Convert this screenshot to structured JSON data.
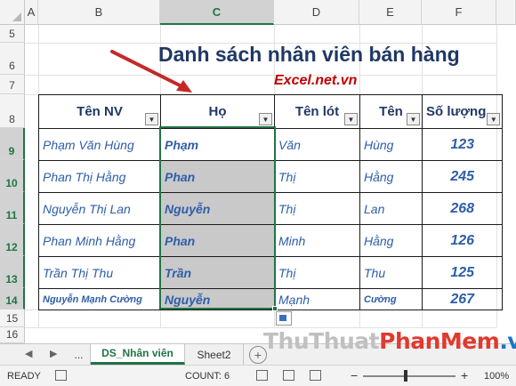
{
  "columns": [
    "A",
    "B",
    "C",
    "D",
    "E",
    "F"
  ],
  "rows": [
    "5",
    "6",
    "7",
    "8",
    "9",
    "10",
    "11",
    "12",
    "13",
    "14",
    "15",
    "16"
  ],
  "title": "Danh sách nhân viên bán hàng",
  "watermark": "Excel.net.vn",
  "table": {
    "headers": [
      "Tên NV",
      "Họ",
      "Tên lót",
      "Tên",
      "Số lượng"
    ],
    "rows": [
      [
        "Phạm Văn Hùng",
        "Phạm",
        "Văn",
        "Hùng",
        "123"
      ],
      [
        "Phan Thị Hằng",
        "Phan",
        "Thị",
        "Hằng",
        "245"
      ],
      [
        "Nguyễn Thị Lan",
        "Nguyễn",
        "Thị",
        "Lan",
        "268"
      ],
      [
        "Phan Minh Hằng",
        "Phan",
        "Minh",
        "Hằng",
        "126"
      ],
      [
        "Trần Thị Thu",
        "Trần",
        "Thị",
        "Thu",
        "125"
      ],
      [
        "Nguyễn Mạnh Cường",
        "Nguyễn",
        "Mạnh",
        "Cường",
        "267"
      ]
    ]
  },
  "tabs": {
    "ellipsis": "...",
    "active": "DS_Nhân viên",
    "other": "Sheet2",
    "add": "+"
  },
  "brand": {
    "part1": "Thu",
    "part2": "Thuat",
    "part3": "PhanMem",
    "part4": ".vn"
  },
  "status": {
    "ready": "READY",
    "count": "COUNT: 6",
    "zoom": "100%",
    "minus": "−",
    "plus": "+"
  },
  "colors": {
    "accent": "#217346",
    "title": "#1f3864",
    "cell_text": "#2e5ea8",
    "watermark": "#c00000"
  }
}
